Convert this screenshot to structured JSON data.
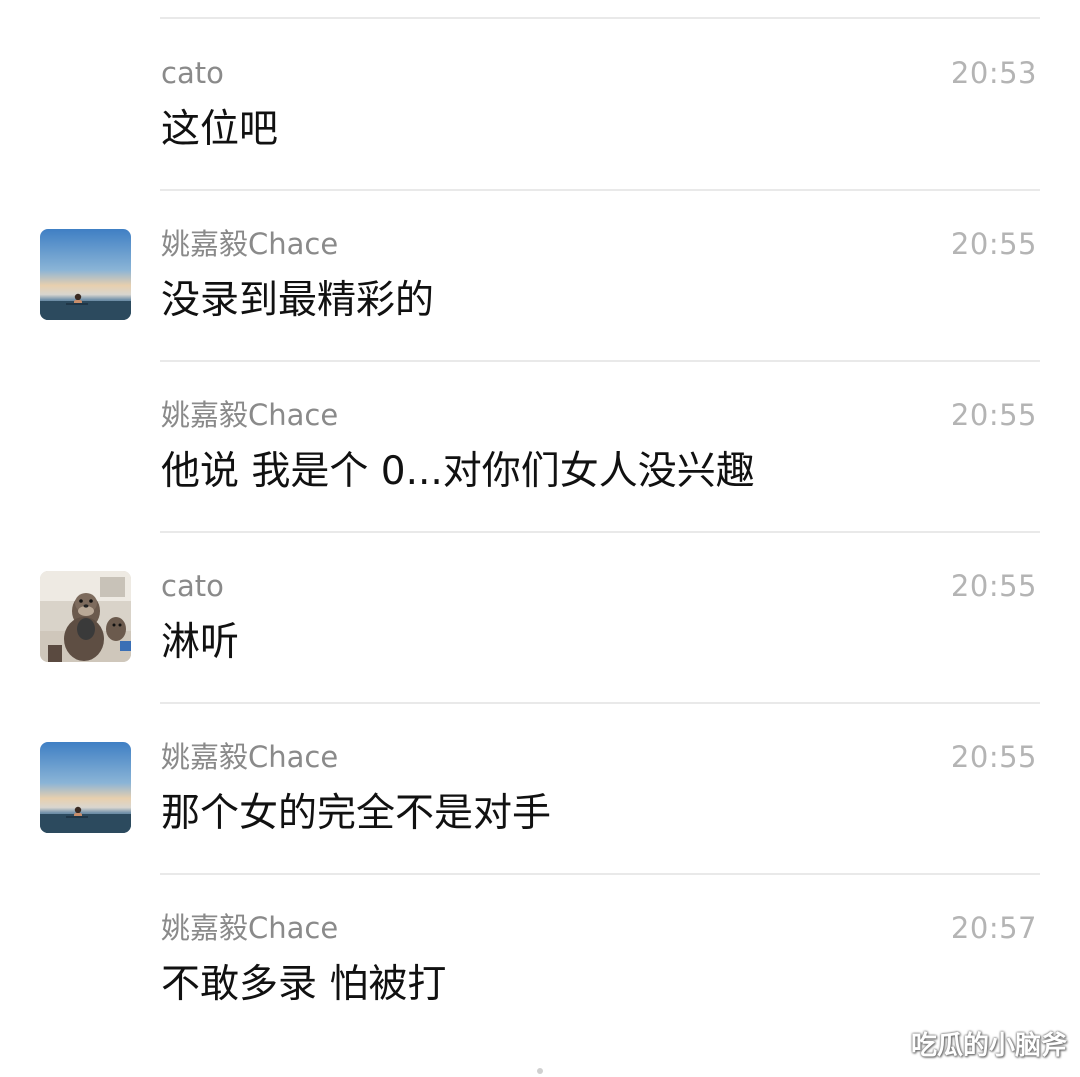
{
  "colors": {
    "background": "#ffffff",
    "sender": "#8a8a8a",
    "time": "#b4b4b4",
    "message": "#111111",
    "separator": "#e9e9e9"
  },
  "messages": [
    {
      "sender": "cato",
      "time": "20:53",
      "text": "这位吧",
      "avatar": "none"
    },
    {
      "sender": "姚嘉毅Chace",
      "time": "20:55",
      "text": "没录到最精彩的",
      "avatar": "sea-sunset-avatar"
    },
    {
      "sender": "姚嘉毅Chace",
      "time": "20:55",
      "text": "他说 我是个 0...对你们女人没兴趣",
      "avatar": "none"
    },
    {
      "sender": "cato",
      "time": "20:55",
      "text": "淋听",
      "avatar": "otter-avatar"
    },
    {
      "sender": "姚嘉毅Chace",
      "time": "20:55",
      "text": "那个女的完全不是对手",
      "avatar": "sea-sunset-avatar"
    },
    {
      "sender": "姚嘉毅Chace",
      "time": "20:57",
      "text": "不敢多录 怕被打",
      "avatar": "none"
    }
  ],
  "watermark": "吃瓜的小脑斧"
}
